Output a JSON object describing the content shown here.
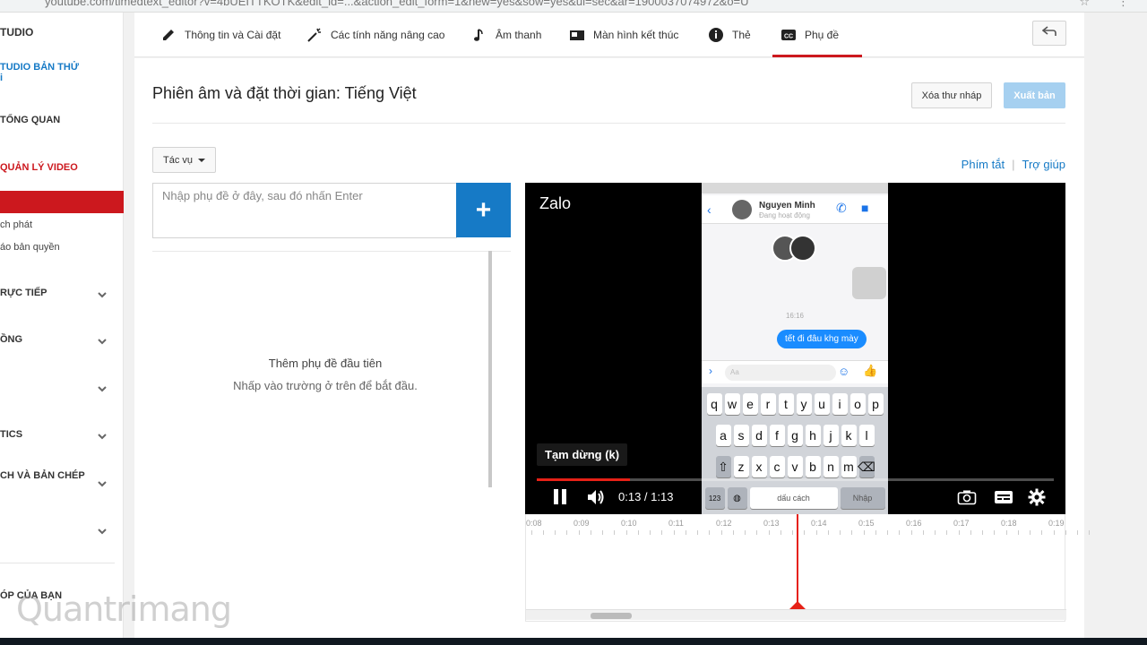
{
  "browser": {
    "url": "youtube.com/timedtext_editor?v=4bUEITTKOTK&edit_id=...&action_edit_form=1&new=yes&sow=yes&ui=sec&ar=1900037074972&o=U"
  },
  "sidebar": {
    "items": [
      {
        "label": "TUDIO",
        "style": "bold"
      },
      {
        "label": "TUDIO BẢN THỬ",
        "style": "blue"
      },
      {
        "label": "TỔNG QUAN",
        "style": "bold"
      },
      {
        "label": "QUẢN LÝ VIDEO",
        "style": "red"
      },
      {
        "label": "ch phát",
        "style": "sub"
      },
      {
        "label": "áo bản quyền",
        "style": "sub"
      },
      {
        "label": "RỰC TIẾP",
        "style": "bold"
      },
      {
        "label": "ỒNG",
        "style": "bold"
      },
      {
        "label": "TICS",
        "style": "bold"
      },
      {
        "label": "CH VÀ BẢN CHÉP",
        "style": "bold"
      },
      {
        "label": "ÓP CỦA BẠN",
        "style": "bold"
      }
    ]
  },
  "topnav": {
    "tabs": [
      {
        "label": "Thông tin và Cài đặt",
        "icon": "pencil-icon"
      },
      {
        "label": "Các tính năng nâng cao",
        "icon": "magic-wand-icon"
      },
      {
        "label": "Âm thanh",
        "icon": "music-note-icon"
      },
      {
        "label": "Màn hình kết thúc",
        "icon": "end-screen-icon"
      },
      {
        "label": "Thẻ",
        "icon": "info-icon"
      },
      {
        "label": "Phụ đề",
        "icon": "cc-icon",
        "active": true
      }
    ]
  },
  "editor": {
    "title": "Phiên âm và đặt thời gian: Tiếng Việt",
    "discard_label": "Xóa thư nháp",
    "publish_label": "Xuất bản",
    "actions_label": "Tác vụ",
    "shortcuts_label": "Phím tắt",
    "help_label": "Trợ giúp",
    "input_placeholder": "Nhập phụ đề ở đây, sau đó nhấn Enter",
    "add_label": "+",
    "empty_title": "Thêm phụ đề đầu tiên",
    "empty_hint": "Nhấp vào trường ở trên để bắt đầu."
  },
  "player": {
    "channel": "Zalo",
    "tooltip": "Tạm dừng (k)",
    "time_current": "0:13",
    "time_total": "1:13",
    "progress": 0.18,
    "phone": {
      "contact_name": "Nguyen Minh",
      "contact_status": "Đang hoạt động",
      "message": "tết đi đâu khg mày",
      "time_stamp": "16:16",
      "compose_placeholder": "Aa",
      "keyboard_rows": [
        [
          "q",
          "w",
          "e",
          "r",
          "t",
          "y",
          "u",
          "i",
          "o",
          "p"
        ],
        [
          "a",
          "s",
          "d",
          "f",
          "g",
          "h",
          "j",
          "k",
          "l"
        ],
        [
          "⇧",
          "z",
          "x",
          "c",
          "v",
          "b",
          "n",
          "m",
          "⌫"
        ]
      ],
      "space_label": "dấu cách",
      "return_label": "Nhập",
      "num_label": "123"
    }
  },
  "timeline": {
    "ticks": [
      "0:08",
      "0:09",
      "0:10",
      "0:11",
      "0:12",
      "0:13",
      "0:14",
      "0:15",
      "0:16",
      "0:17",
      "0:18",
      "0:19"
    ]
  },
  "watermark": "Quantrimang",
  "colors": {
    "accent_red": "#cc181e",
    "accent_blue": "#167ac6",
    "publish_disabled": "#a6d0f0"
  }
}
